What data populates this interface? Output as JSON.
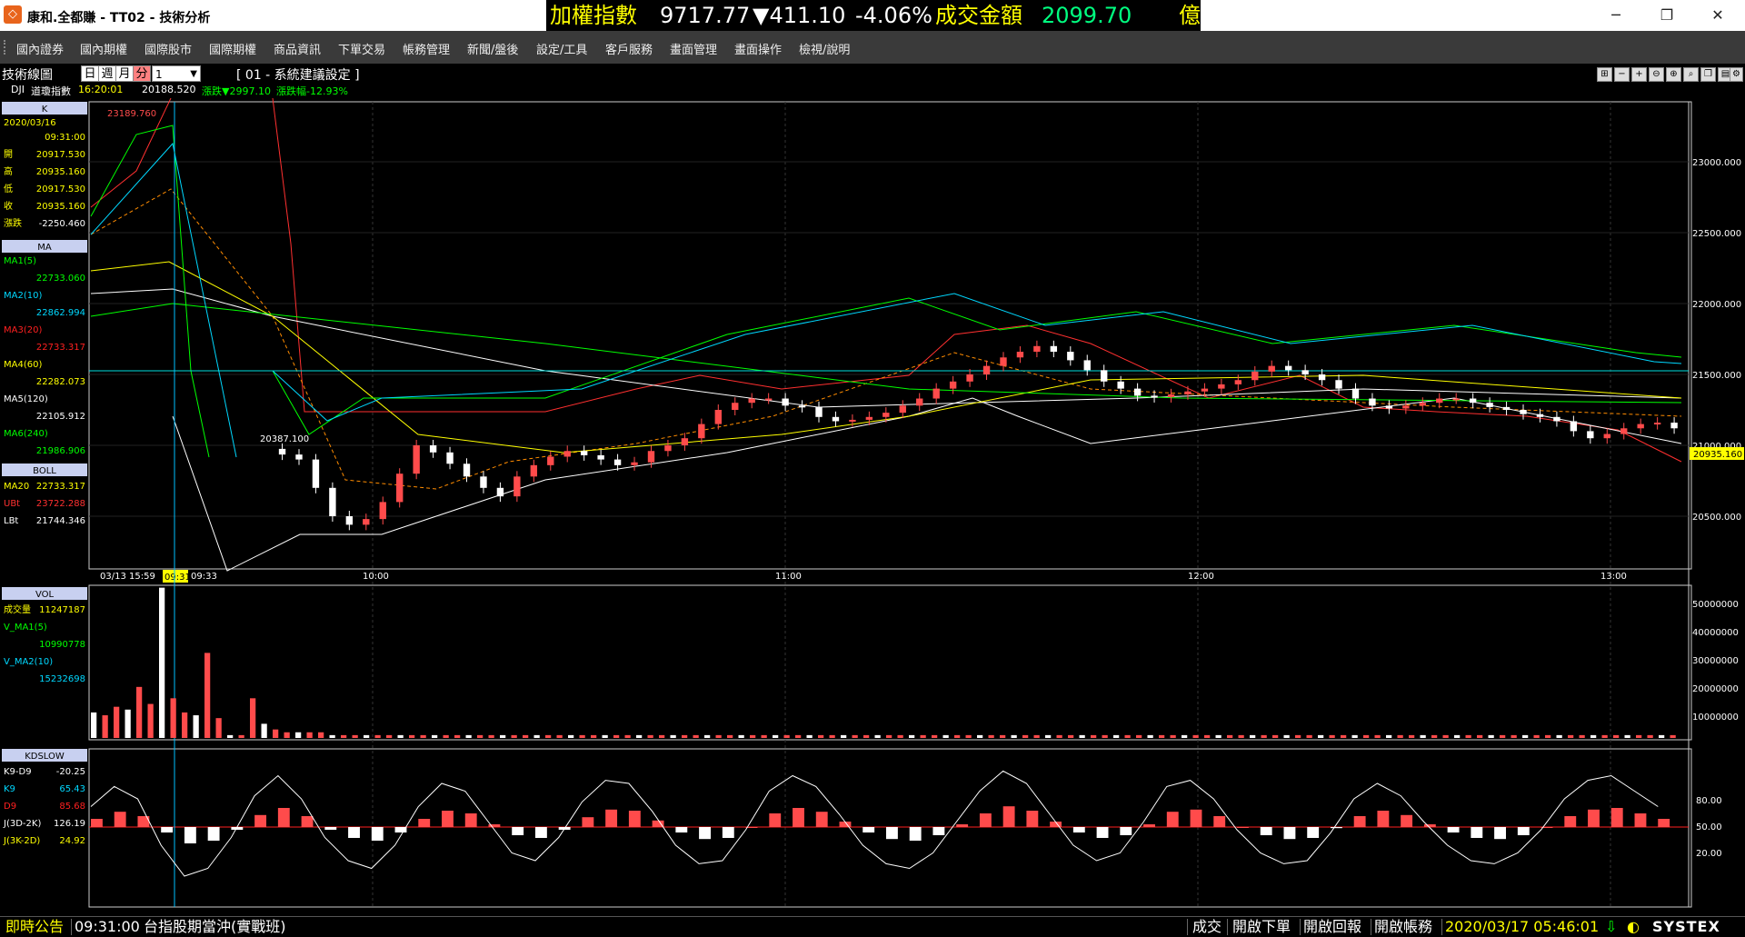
{
  "window": {
    "title": "康和.全都賺 - TT02 - 技術分析",
    "minimize": "─",
    "maximize": "❐",
    "close": "✕"
  },
  "ticker": {
    "name": "加權指數",
    "price": "9717.77",
    "change": "▼411.10",
    "pct": "-4.06%",
    "vol_label": "成交金額",
    "vol_value": "2099.70",
    "unit": "億"
  },
  "menu": [
    "國內證券",
    "國內期權",
    "國際股市",
    "國際期權",
    "商品資訊",
    "下單交易",
    "帳務管理",
    "新聞/盤後",
    "設定/工具",
    "客戶服務",
    "畫面管理",
    "畫面操作",
    "檢視/說明"
  ],
  "toolbar": {
    "panel_title": "技術線圖",
    "timeframes": [
      "日",
      "週",
      "月",
      "分"
    ],
    "period_value": "1",
    "setting_label": "[ 01 - 系統建議設定 ]",
    "info": {
      "symbol": "DJI",
      "name": "道瓊指數",
      "time": "16:20:01",
      "price": "20188.520",
      "chg_label": "漲跌▼2997.10",
      "pct_label": "漲跌幅-12.93%"
    }
  },
  "colors": {
    "up": "#ff4b4b",
    "down": "#ffffff",
    "ma1": "#00ff00",
    "ma2": "#00d8ff",
    "ma3": "#ff2020",
    "ma4": "#ffff00",
    "ma5": "#ffffff",
    "ma6": "#00ff00",
    "boll_mid": "#ff8c00",
    "boll_up": "#ff3030",
    "boll_low": "#ffffff",
    "cursor": "#00c0ff",
    "hline": "#00e0e0",
    "ticker_up": "#ffff00",
    "ticker_down": "#ffffff",
    "ticker_vol": "#00ff80"
  },
  "k_panel": {
    "label": "K",
    "date": "2020/03/16",
    "time": "09:31:00",
    "rows": [
      {
        "label": "開",
        "value": "20917.530"
      },
      {
        "label": "高",
        "value": "20935.160"
      },
      {
        "label": "低",
        "value": "20917.530"
      },
      {
        "label": "收",
        "value": "20935.160"
      },
      {
        "label": "漲跌",
        "value": "-2250.460"
      }
    ]
  },
  "ma_panel": {
    "label": "MA",
    "items": [
      {
        "label": "MA1(5)",
        "value": "22733.060"
      },
      {
        "label": "MA2(10)",
        "value": "22862.994"
      },
      {
        "label": "MA3(20)",
        "value": "22733.317"
      },
      {
        "label": "MA4(60)",
        "value": "22282.073"
      },
      {
        "label": "MA5(120)",
        "value": "22105.912"
      },
      {
        "label": "MA6(240)",
        "value": "21986.906"
      }
    ]
  },
  "boll_panel": {
    "label": "BOLL",
    "items": [
      {
        "label": "MA20",
        "value": "22733.317"
      },
      {
        "label": "UBt",
        "value": "23722.288"
      },
      {
        "label": "LBt",
        "value": "21744.346"
      }
    ]
  },
  "vol_panel": {
    "label": "VOL",
    "items": [
      {
        "label": "成交量",
        "value": "11247187"
      },
      {
        "label": "V_MA1(5)",
        "value": "10990778"
      },
      {
        "label": "V_MA2(10)",
        "value": "15232698"
      }
    ]
  },
  "kd_panel": {
    "label": "KDSLOW",
    "items": [
      {
        "label": "K9-D9",
        "value": "-20.25"
      },
      {
        "label": "K9",
        "value": "65.43"
      },
      {
        "label": "D9",
        "value": "85.68"
      },
      {
        "label": "J(3D-2K)",
        "value": "126.19"
      },
      {
        "label": "J(3K-2D)",
        "value": "24.92"
      }
    ]
  },
  "price_axis": [
    "23000.000",
    "22500.000",
    "22000.000",
    "21500.000",
    "21000.000",
    "20500.000"
  ],
  "price_marker": "20935.160",
  "high_label": "23189.760",
  "low_label": "20387.100",
  "time_axis": {
    "first_date": "03/13 15:59",
    "cursor_time": "09:31",
    "ticks": [
      "09:33",
      "10:00",
      "11:00",
      "12:00",
      "13:00"
    ]
  },
  "vol_axis": [
    "50000000",
    "40000000",
    "30000000",
    "20000000",
    "10000000"
  ],
  "kd_axis": [
    "80.00",
    "50.00",
    "20.00"
  ],
  "chart_data": {
    "type": "candlestick",
    "close_series": [
      20935,
      20900,
      20700,
      20500,
      20440,
      20480,
      20600,
      20800,
      21000,
      20950,
      20870,
      20780,
      20700,
      20640,
      20780,
      20860,
      20920,
      20960,
      20930,
      20900,
      20860,
      20880,
      20960,
      21000,
      21050,
      21150,
      21250,
      21300,
      21330,
      21330,
      21280,
      21270,
      21200,
      21170,
      21180,
      21200,
      21230,
      21280,
      21330,
      21400,
      21450,
      21500,
      21560,
      21620,
      21660,
      21700,
      21660,
      21600,
      21530,
      21450,
      21400,
      21350,
      21340,
      21360,
      21380,
      21400,
      21430,
      21460,
      21520,
      21560,
      21530,
      21500,
      21460,
      21400,
      21330,
      21280,
      21260,
      21280,
      21300,
      21330,
      21330,
      21300,
      21270,
      21250,
      21220,
      21200,
      21170,
      21100,
      21050,
      21080,
      21120,
      21150,
      21160,
      21120
    ],
    "volume_series": [
      9,
      8,
      11,
      10,
      18,
      12,
      53,
      14,
      9,
      8,
      30,
      7,
      1,
      1,
      14,
      5,
      3,
      2,
      2,
      2,
      2,
      1,
      1,
      1,
      1,
      1,
      1,
      1
    ],
    "kd_series": [
      65,
      78,
      70,
      40,
      20,
      25,
      45,
      72,
      85,
      70,
      45,
      30,
      25,
      40,
      65,
      80,
      75,
      55,
      35,
      30,
      45,
      68,
      82,
      80,
      62,
      40,
      28,
      30,
      50,
      75,
      85,
      78,
      60,
      40,
      28,
      25,
      35,
      55,
      75,
      88,
      80,
      60,
      40,
      30,
      35,
      55,
      78,
      82,
      70,
      50,
      35,
      28,
      30,
      48,
      70,
      80,
      72,
      55,
      40,
      30,
      28,
      35,
      50,
      70,
      82,
      85,
      75,
      65
    ]
  },
  "status": {
    "notice_label": "即時公告",
    "time": "09:31:00",
    "message": "台指股期當沖(實戰班)",
    "btn_trade": "成交",
    "btn_order": "開啟下單",
    "btn_report": "開啟回報",
    "btn_account": "開啟帳務",
    "datetime": "2020/03/17 05:46:01",
    "brand": "SYSTEX"
  }
}
